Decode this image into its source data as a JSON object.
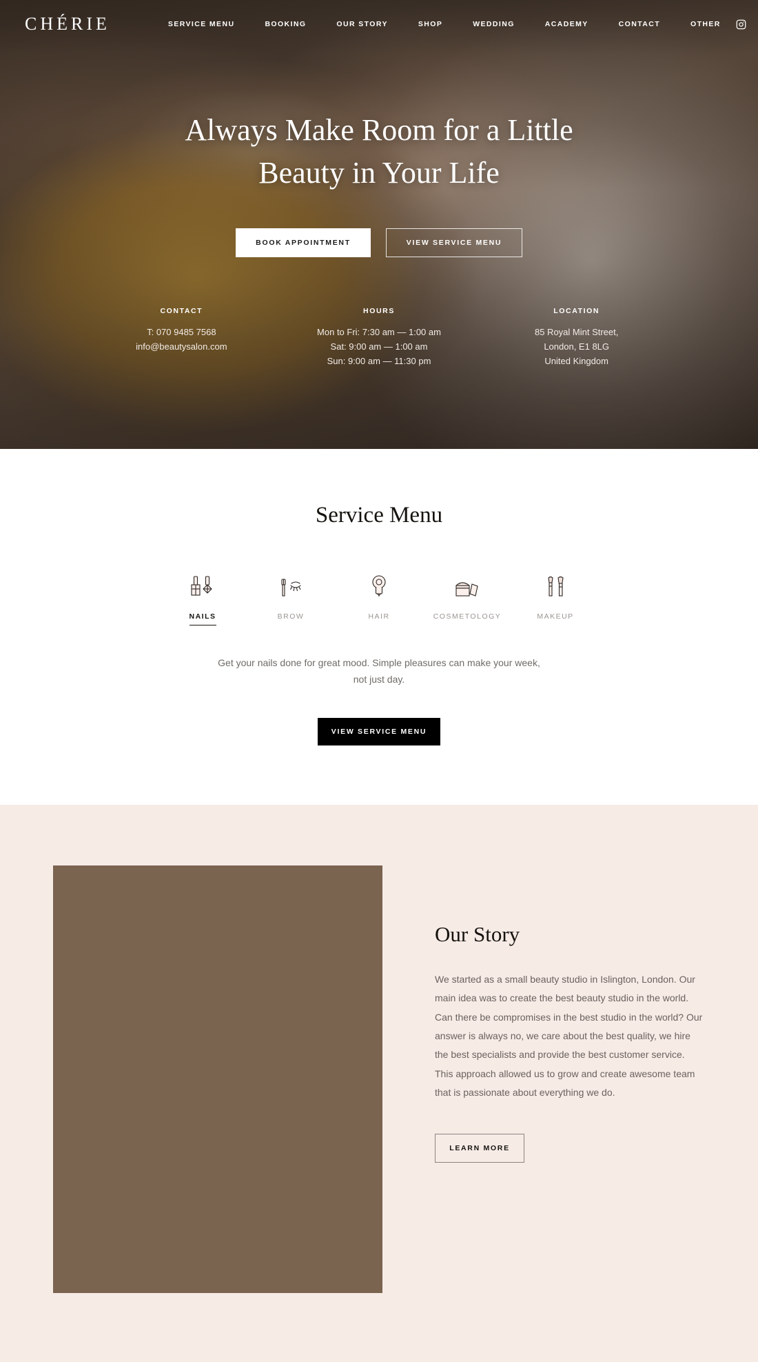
{
  "brand": "CHÉRIE",
  "nav": {
    "links": [
      {
        "label": "SERVICE MENU"
      },
      {
        "label": "BOOKING"
      },
      {
        "label": "OUR STORY"
      },
      {
        "label": "SHOP"
      },
      {
        "label": "WEDDING"
      },
      {
        "label": "ACADEMY"
      },
      {
        "label": "CONTACT"
      },
      {
        "label": "OTHER"
      }
    ],
    "social": [
      {
        "name": "instagram-icon"
      },
      {
        "name": "facebook-icon"
      }
    ]
  },
  "hero": {
    "title_line1": "Always Make Room for a Little",
    "title_line2": "Beauty in Your Life",
    "primary_button": "BOOK APPOINTMENT",
    "secondary_button": "VIEW SERVICE MENU",
    "info": {
      "contact": {
        "title": "CONTACT",
        "phone": "T: 070 9485 7568",
        "email": "info@beautysalon.com"
      },
      "hours": {
        "title": "HOURS",
        "line1": "Mon to Fri: 7:30 am — 1:00 am",
        "line2": "Sat: 9:00 am — 1:00 am",
        "line3": "Sun: 9:00 am — 11:30 pm"
      },
      "location": {
        "title": "LOCATION",
        "line1": "85 Royal Mint Street,",
        "line2": "London, E1 8LG",
        "line3": "United Kingdom"
      }
    }
  },
  "services": {
    "title": "Service Menu",
    "tabs": [
      {
        "label": "NAILS",
        "icon": "nail-polish-icon",
        "active": true
      },
      {
        "label": "BROW",
        "icon": "brow-brush-icon",
        "active": false
      },
      {
        "label": "HAIR",
        "icon": "hair-dryer-icon",
        "active": false
      },
      {
        "label": "COSMETOLOGY",
        "icon": "cosmetic-jars-icon",
        "active": false
      },
      {
        "label": "MAKEUP",
        "icon": "makeup-brush-icon",
        "active": false
      }
    ],
    "description": "Get your nails done for great mood. Simple pleasures can make your week, not just day.",
    "button": "VIEW SERVICE MENU"
  },
  "story": {
    "title": "Our Story",
    "body": "We started as a small beauty studio in Islington, London. Our main idea was to create the best beauty studio in the world. Can there be compromises in the best studio in the world? Our answer is always no, we care about the best quality, we hire the best specialists and provide the best customer service. This approach allowed us to grow and create awesome team that is passionate about everything we do.",
    "button": "LEARN MORE"
  },
  "colors": {
    "accent_pink": "#f7ebe6",
    "dark": "#16130f",
    "muted_text": "#6a625d",
    "white": "#ffffff"
  }
}
